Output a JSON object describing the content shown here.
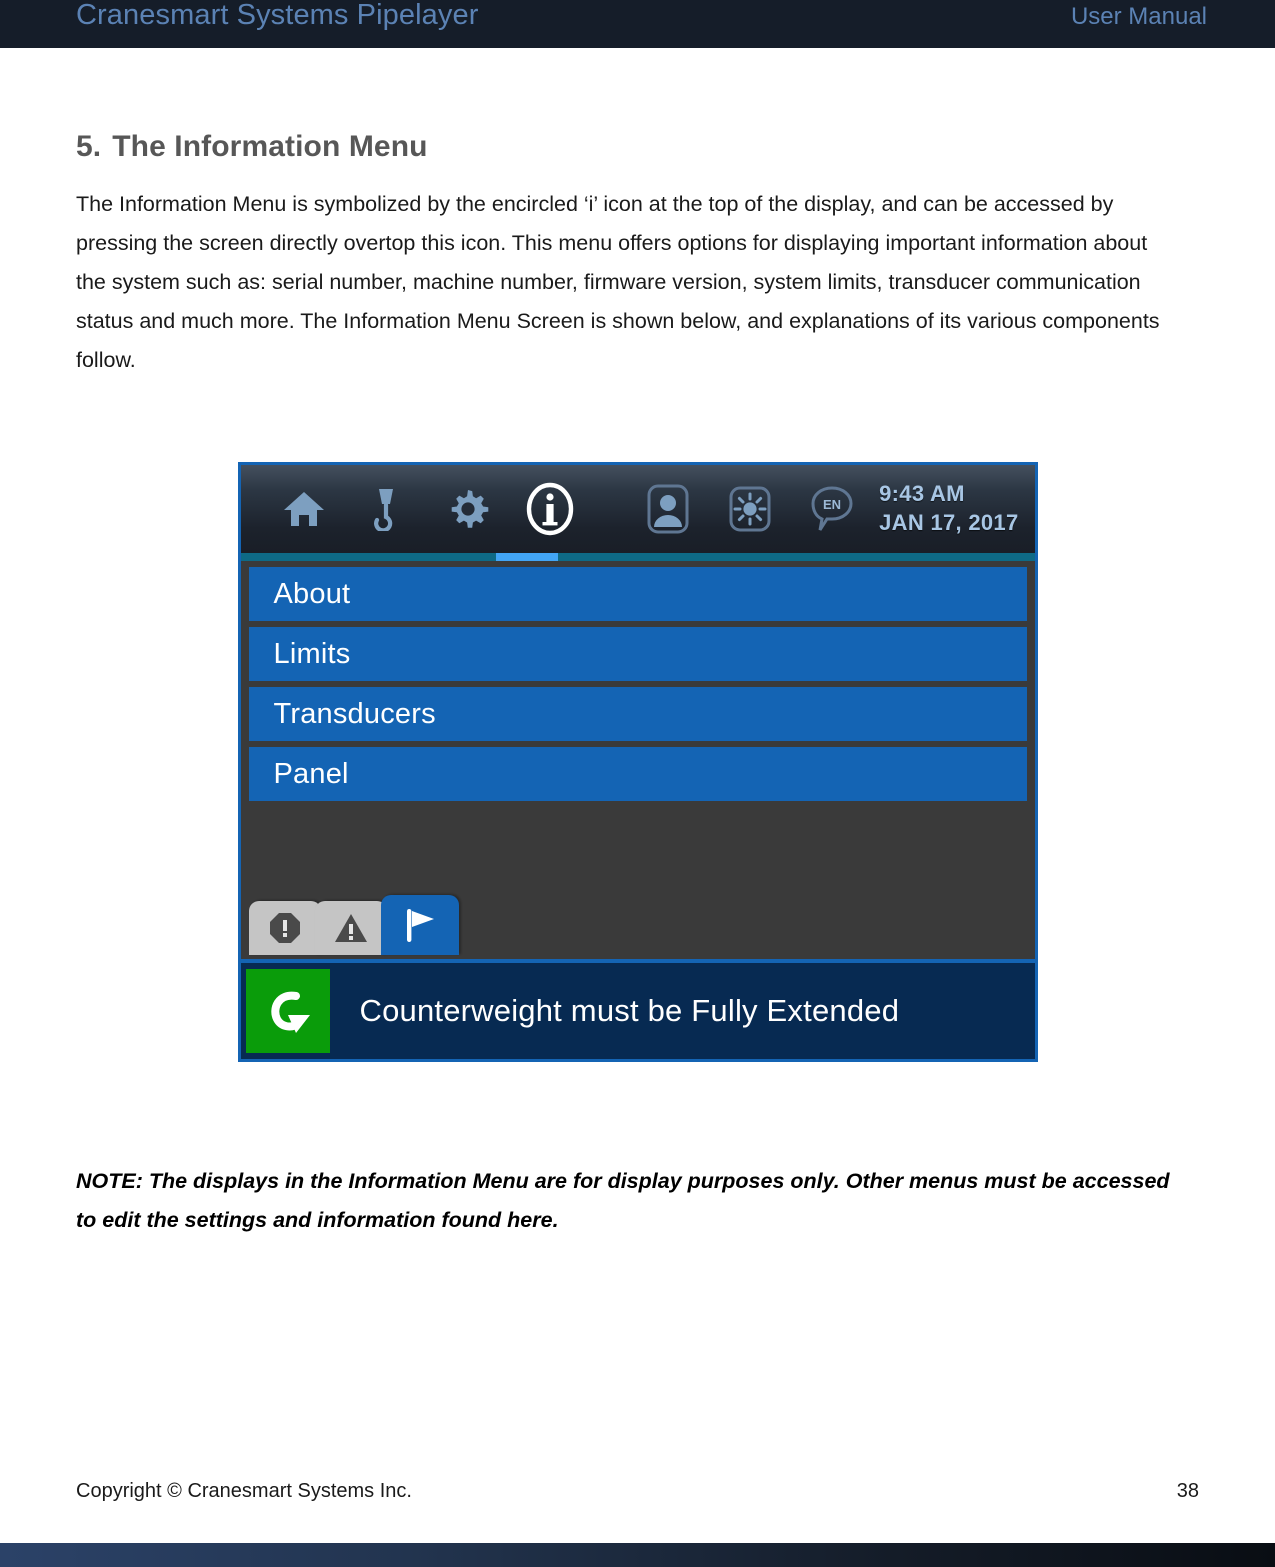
{
  "header": {
    "title_left": "Cranesmart Systems Pipelayer",
    "title_right": "User Manual"
  },
  "section": {
    "number": "5.",
    "heading": "The Information Menu",
    "paragraph": "The Information Menu is symbolized by the encircled ‘i’ icon at the top of the display, and can be accessed by pressing the screen directly overtop this icon.  This menu offers options for displaying important information about the system such as: serial number, machine number, firmware version, system limits, transducer communication status and much more.  The Information Menu Screen is shown below, and explanations of its various components follow."
  },
  "device": {
    "toolbar": {
      "icons": [
        {
          "name": "home-icon",
          "label": "Home"
        },
        {
          "name": "hook-icon",
          "label": "Hook"
        },
        {
          "name": "gear-icon",
          "label": "Settings"
        },
        {
          "name": "info-circle-icon",
          "label": "Information",
          "active": true
        },
        {
          "name": "user-icon",
          "label": "User"
        },
        {
          "name": "brightness-icon",
          "label": "Brightness"
        },
        {
          "name": "language-bubble-icon",
          "label": "EN"
        }
      ],
      "time": "9:43 AM",
      "date": "JAN 17, 2017"
    },
    "menu_items": [
      {
        "label": "About"
      },
      {
        "label": "Limits"
      },
      {
        "label": "Transducers"
      },
      {
        "label": "Panel"
      }
    ],
    "tabs": [
      {
        "name": "alarm-tab",
        "icon": "octagon-exclamation-icon",
        "selected": false
      },
      {
        "name": "warning-tab",
        "icon": "triangle-exclamation-icon",
        "selected": false
      },
      {
        "name": "flag-tab",
        "icon": "flag-icon",
        "selected": true
      }
    ],
    "status": {
      "icon": "rotate-arrow-icon",
      "message": "Counterweight must be Fully Extended"
    },
    "colors": {
      "menu_blue": "#1464b4",
      "accent_cyan": "#42a5f5",
      "status_green": "#0a9c0a",
      "status_navy": "#072a52",
      "screen_gray": "#3a3a3a",
      "toolbar_icon_blue": "#7d9fc0"
    }
  },
  "note": {
    "text": "NOTE: The displays in the Information Menu are for display purposes only.  Other menus must be accessed to edit the settings and information found here."
  },
  "footer": {
    "copyright": "Copyright © Cranesmart Systems Inc.",
    "page_number": "38"
  }
}
